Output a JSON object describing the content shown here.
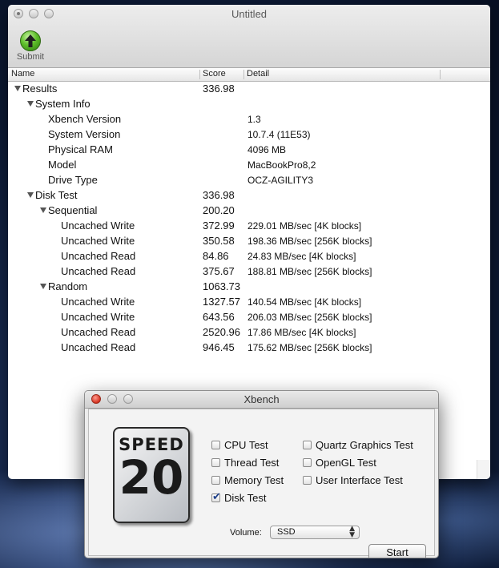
{
  "main_window": {
    "title": "Untitled",
    "toolbar": {
      "submit_label": "Submit",
      "submit_icon": "arrow-up-icon"
    },
    "columns": {
      "name": "Name",
      "score": "Score",
      "detail": "Detail"
    },
    "rows": [
      {
        "name": "Results",
        "score": "336.98",
        "detail": ""
      },
      {
        "name": "System Info",
        "score": "",
        "detail": ""
      },
      {
        "name": "Xbench Version",
        "score": "",
        "detail": "1.3"
      },
      {
        "name": "System Version",
        "score": "",
        "detail": "10.7.4 (11E53)"
      },
      {
        "name": "Physical RAM",
        "score": "",
        "detail": "4096 MB"
      },
      {
        "name": "Model",
        "score": "",
        "detail": "MacBookPro8,2"
      },
      {
        "name": "Drive Type",
        "score": "",
        "detail": "OCZ-AGILITY3"
      },
      {
        "name": "Disk Test",
        "score": "336.98",
        "detail": ""
      },
      {
        "name": "Sequential",
        "score": "200.20",
        "detail": ""
      },
      {
        "name": "Uncached Write",
        "score": "372.99",
        "detail": "229.01 MB/sec [4K blocks]"
      },
      {
        "name": "Uncached Write",
        "score": "350.58",
        "detail": "198.36 MB/sec [256K blocks]"
      },
      {
        "name": "Uncached Read",
        "score": "84.86",
        "detail": "24.83 MB/sec [4K blocks]"
      },
      {
        "name": "Uncached Read",
        "score": "375.67",
        "detail": "188.81 MB/sec [256K blocks]"
      },
      {
        "name": "Random",
        "score": "1063.73",
        "detail": ""
      },
      {
        "name": "Uncached Write",
        "score": "1327.57",
        "detail": "140.54 MB/sec [4K blocks]"
      },
      {
        "name": "Uncached Write",
        "score": "643.56",
        "detail": "206.03 MB/sec [256K blocks]"
      },
      {
        "name": "Uncached Read",
        "score": "2520.96",
        "detail": "17.86 MB/sec [4K blocks]"
      },
      {
        "name": "Uncached Read",
        "score": "946.45",
        "detail": "175.62 MB/sec [256K blocks]"
      }
    ]
  },
  "dialog": {
    "title": "Xbench",
    "logo": {
      "line1": "SPEED",
      "line2": "20"
    },
    "options": {
      "cpu_test": {
        "label": "CPU Test",
        "checked": false
      },
      "thread_test": {
        "label": "Thread Test",
        "checked": false
      },
      "memory_test": {
        "label": "Memory Test",
        "checked": false
      },
      "disk_test": {
        "label": "Disk Test",
        "checked": true
      },
      "quartz_graphics_test": {
        "label": "Quartz Graphics Test",
        "checked": false
      },
      "opengl_test": {
        "label": "OpenGL Test",
        "checked": false
      },
      "user_interface_test": {
        "label": "User Interface Test",
        "checked": false
      }
    },
    "volume_label": "Volume:",
    "volume_value": "SSD",
    "start_label": "Start"
  }
}
